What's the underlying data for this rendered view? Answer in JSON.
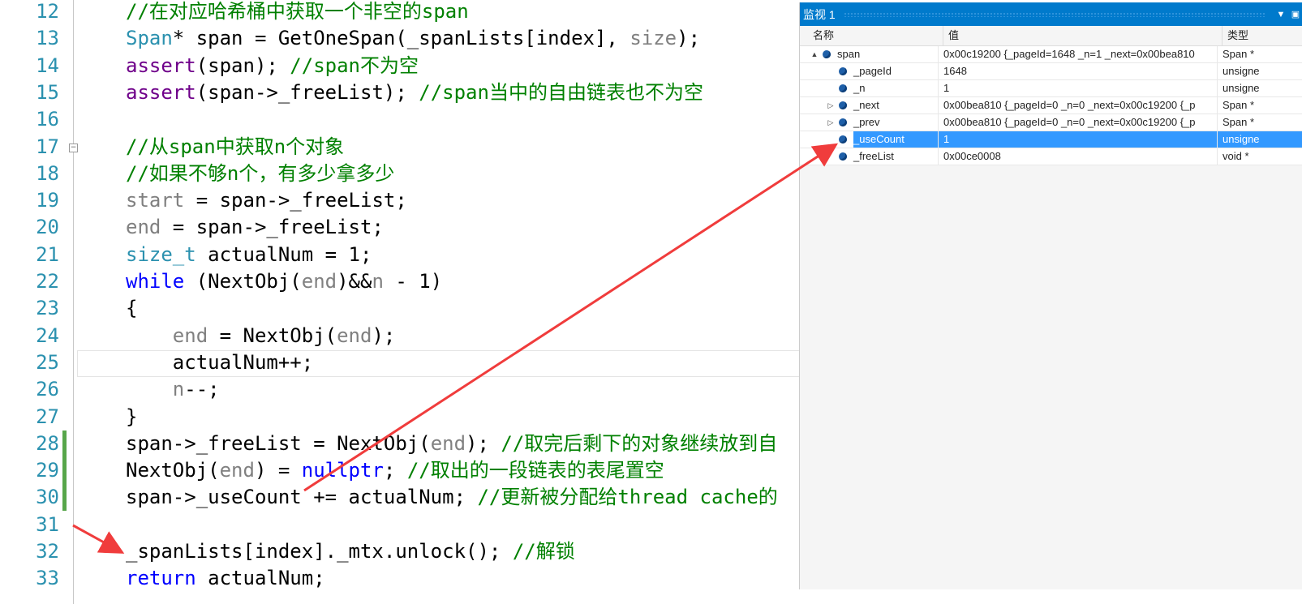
{
  "editor": {
    "lines": [
      {
        "n": "12",
        "segs": [
          [
            "//在对应哈希桶中获取一个非空的span",
            "comment"
          ]
        ]
      },
      {
        "n": "13",
        "segs": [
          [
            "Span",
            "type"
          ],
          [
            "* span = GetOneSpan(_spanLists[index], ",
            "plain"
          ],
          [
            "size",
            "param"
          ],
          [
            ");",
            "plain"
          ]
        ]
      },
      {
        "n": "14",
        "segs": [
          [
            "assert",
            "macro"
          ],
          [
            "(span); ",
            "plain"
          ],
          [
            "//span不为空",
            "comment"
          ]
        ]
      },
      {
        "n": "15",
        "segs": [
          [
            "assert",
            "macro"
          ],
          [
            "(span->_freeList); ",
            "plain"
          ],
          [
            "//span当中的自由链表也不为空",
            "comment"
          ]
        ]
      },
      {
        "n": "16",
        "segs": []
      },
      {
        "n": "17",
        "segs": [
          [
            "//从span中获取n个对象",
            "comment"
          ]
        ]
      },
      {
        "n": "18",
        "segs": [
          [
            "//如果不够n个，有多少拿多少",
            "comment"
          ]
        ]
      },
      {
        "n": "19",
        "segs": [
          [
            "start",
            "param"
          ],
          [
            " = span->_freeList;",
            "plain"
          ]
        ]
      },
      {
        "n": "20",
        "segs": [
          [
            "end",
            "param"
          ],
          [
            " = span->_freeList;",
            "plain"
          ]
        ]
      },
      {
        "n": "21",
        "segs": [
          [
            "size_t",
            "type"
          ],
          [
            " actualNum = 1;",
            "plain"
          ]
        ]
      },
      {
        "n": "22",
        "segs": [
          [
            "while",
            "kw"
          ],
          [
            " (NextObj(",
            "plain"
          ],
          [
            "end",
            "param"
          ],
          [
            ")&&",
            "plain"
          ],
          [
            "n",
            "param"
          ],
          [
            " - 1)",
            "plain"
          ]
        ]
      },
      {
        "n": "23",
        "segs": [
          [
            "{",
            "plain"
          ]
        ]
      },
      {
        "n": "24",
        "segs": [
          [
            "    ",
            "plain"
          ],
          [
            "end",
            "param"
          ],
          [
            " = NextObj(",
            "plain"
          ],
          [
            "end",
            "param"
          ],
          [
            ");",
            "plain"
          ]
        ]
      },
      {
        "n": "25",
        "segs": [
          [
            "    actualNum++;",
            "plain"
          ]
        ]
      },
      {
        "n": "26",
        "segs": [
          [
            "    ",
            "plain"
          ],
          [
            "n",
            "param"
          ],
          [
            "--;",
            "plain"
          ]
        ]
      },
      {
        "n": "27",
        "segs": [
          [
            "}",
            "plain"
          ]
        ]
      },
      {
        "n": "28",
        "segs": [
          [
            "span->_freeList = NextObj(",
            "plain"
          ],
          [
            "end",
            "param"
          ],
          [
            "); ",
            "plain"
          ],
          [
            "//取完后剩下的对象继续放到自",
            "comment"
          ]
        ]
      },
      {
        "n": "29",
        "segs": [
          [
            "NextObj(",
            "plain"
          ],
          [
            "end",
            "param"
          ],
          [
            ") = ",
            "plain"
          ],
          [
            "nullptr",
            "kw"
          ],
          [
            "; ",
            "plain"
          ],
          [
            "//取出的一段链表的表尾置空",
            "comment"
          ]
        ]
      },
      {
        "n": "30",
        "segs": [
          [
            "span->_useCount += actualNum; ",
            "plain"
          ],
          [
            "//更新被分配给thread cache的",
            "comment"
          ]
        ]
      },
      {
        "n": "31",
        "segs": []
      },
      {
        "n": "32",
        "segs": [
          [
            "_spanLists[index]._mtx.unlock(); ",
            "plain"
          ],
          [
            "//解锁",
            "comment"
          ]
        ]
      },
      {
        "n": "33",
        "segs": [
          [
            "return",
            "kw"
          ],
          [
            " actualNum;",
            "plain"
          ]
        ]
      }
    ],
    "changed_lines": [
      "28",
      "29",
      "30"
    ],
    "current_line": "25",
    "fold_line": "17"
  },
  "watch": {
    "title": "监视 1",
    "headers": {
      "name": "名称",
      "value": "值",
      "type": "类型"
    },
    "rows": [
      {
        "name": "span",
        "value": "0x00c19200 {_pageId=1648 _n=1 _next=0x00bea810",
        "type": "Span *",
        "expander": "▲",
        "level": 0,
        "selected": false
      },
      {
        "name": "_pageId",
        "value": "1648",
        "type": "unsigne",
        "expander": "",
        "level": 1,
        "selected": false
      },
      {
        "name": "_n",
        "value": "1",
        "type": "unsigne",
        "expander": "",
        "level": 1,
        "selected": false
      },
      {
        "name": "_next",
        "value": "0x00bea810 {_pageId=0 _n=0 _next=0x00c19200 {_p",
        "type": "Span *",
        "expander": "▷",
        "level": 1,
        "selected": false
      },
      {
        "name": "_prev",
        "value": "0x00bea810 {_pageId=0 _n=0 _next=0x00c19200 {_p",
        "type": "Span *",
        "expander": "▷",
        "level": 1,
        "selected": false
      },
      {
        "name": "_useCount",
        "value": "1",
        "type": "unsigne",
        "expander": "",
        "level": 1,
        "selected": true
      },
      {
        "name": "_freeList",
        "value": "0x00ce0008",
        "type": "void *",
        "expander": "",
        "level": 1,
        "selected": false
      }
    ]
  },
  "colors": {
    "accent": "#007acc",
    "selection": "#3399ff",
    "arrow": "#f03c3c",
    "comment": "#008000",
    "type": "#2b91af",
    "macro": "#6f008a",
    "keyword": "#0000ff"
  }
}
